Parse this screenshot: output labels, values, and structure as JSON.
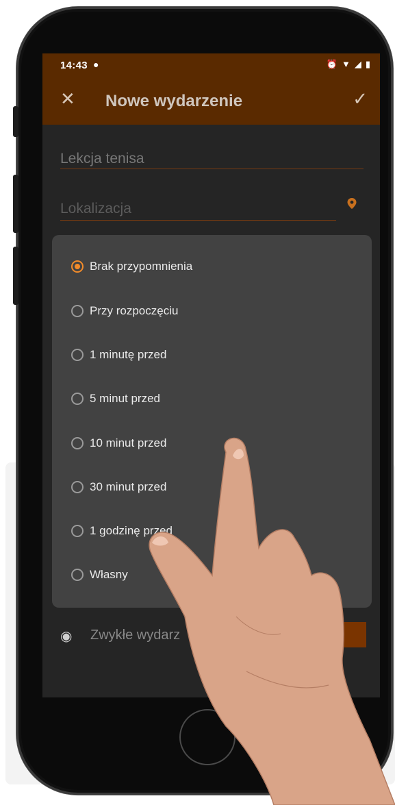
{
  "status_bar": {
    "time": "14:43"
  },
  "app_bar": {
    "title": "Nowe wydarzenie"
  },
  "form": {
    "title_value": "Lekcja tenisa",
    "location_placeholder": "Lokalizacja",
    "event_type_label": "Zwykłe wydarz"
  },
  "reminder_dialog": {
    "options": [
      {
        "label": "Brak przypomnienia",
        "selected": true
      },
      {
        "label": "Przy rozpoczęciu",
        "selected": false
      },
      {
        "label": "1 minutę przed",
        "selected": false
      },
      {
        "label": "5 minut przed",
        "selected": false
      },
      {
        "label": "10 minut przed",
        "selected": false
      },
      {
        "label": "30 minut przed",
        "selected": false
      },
      {
        "label": "1 godzinę przed",
        "selected": false
      },
      {
        "label": "Własny",
        "selected": false
      }
    ]
  },
  "colors": {
    "app_bar": "#5a2a00",
    "accent": "#f28b2a",
    "dialog": "#424242",
    "screen_bg": "#252525",
    "event_color_swatch": "#7a3400"
  },
  "icons": [
    "notification-icon",
    "alarm-icon",
    "wifi-icon",
    "signal-icon",
    "battery-icon",
    "close-icon",
    "check-icon",
    "location-pin-icon",
    "palette-icon"
  ]
}
